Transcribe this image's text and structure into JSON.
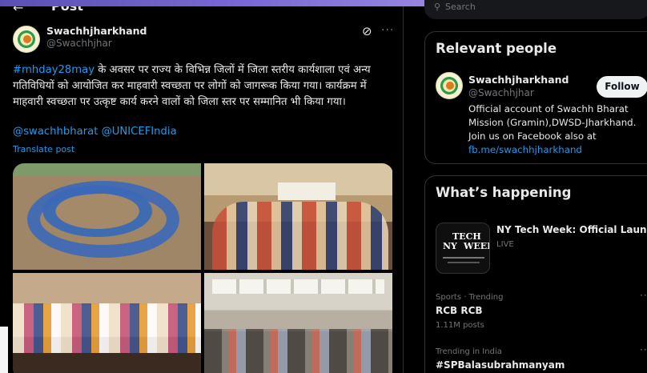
{
  "header": {
    "back_icon": "arrow-left-icon",
    "title": "Post"
  },
  "post": {
    "author_name": "Swachhjharkhand",
    "author_handle": "@Swachhjhar",
    "hashtag": "#mhday28may",
    "text": " के अवसर पर राज्य के विभिन्न जिलों में जिला स्तरीय कार्यशाला एवं अन्य गतिविधियों को आयोजित कर माहवारी स्वच्छता पर लोगों को जागरूक किया गया। कार्यक्रम में माहवारी स्वच्छता पर उत्कृष्ट कार्य करने वालों को जिला स्तर पर सम्मानित भी किया गया।",
    "mentions": "@swachhbharat @UNICEFIndia",
    "translate_label": "Translate post",
    "grok_icon": "grok-icon",
    "more_icon": "more-icon"
  },
  "search": {
    "placeholder": "Search",
    "icon": "search-icon"
  },
  "relevant_people": {
    "title": "Relevant people",
    "name": "Swachhjharkhand",
    "handle": "@Swachhjhar",
    "follow_label": "Follow",
    "bio": "Official account of Swachh Bharat Mission (Gramin),DWSD-Jharkhand. Join us on Facebook also at ",
    "bio_link": "fb.me/swachhjharkhand"
  },
  "whats_happening": {
    "title": "What’s happening",
    "thumb_line1": "TECH",
    "thumb_line2a": "NY",
    "thumb_line2b": "WEEK",
    "event_title": "NY Tech Week: Official Launch",
    "event_status": "LIVE",
    "trends": [
      {
        "context": "Sports · Trending",
        "name": "RCB RCB",
        "count": "1.11M posts"
      },
      {
        "context": "Trending in India",
        "name": "#SPBalasubrahmanyam",
        "count": ""
      }
    ]
  },
  "colors": {
    "accent": "#1d9bf0",
    "background": "#000000",
    "border": "#2f3336",
    "muted": "#71767b"
  }
}
